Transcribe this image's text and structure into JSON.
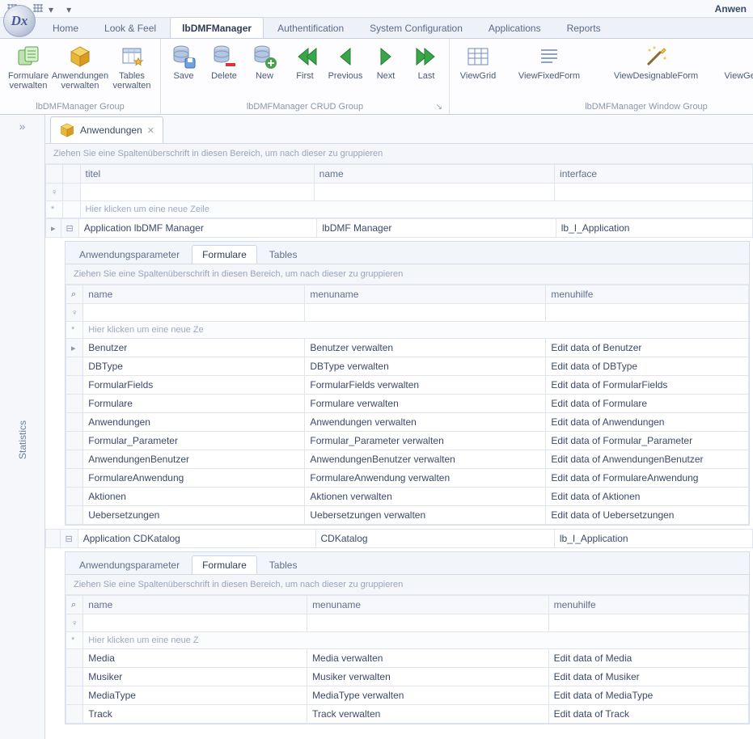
{
  "app_title": "Anwen",
  "tabs": [
    "Home",
    "Look & Feel",
    "lbDMFManager",
    "Authentification",
    "System Configuration",
    "Applications",
    "Reports"
  ],
  "active_tab_index": 2,
  "ribbon": {
    "groups": [
      {
        "caption": "lbDMFManager Group",
        "buttons": [
          {
            "label": "Formulare verwalten",
            "icon": "forms-icon"
          },
          {
            "label": "Anwendungen verwalten",
            "icon": "cube-icon"
          },
          {
            "label": "Tables verwalten",
            "icon": "table-star-icon"
          }
        ]
      },
      {
        "caption": "lbDMFManager CRUD Group",
        "buttons": [
          {
            "label": "Save",
            "icon": "db-save-icon"
          },
          {
            "label": "Delete",
            "icon": "db-delete-icon"
          },
          {
            "label": "New",
            "icon": "db-add-icon"
          },
          {
            "label": "First",
            "icon": "nav-first-icon"
          },
          {
            "label": "Previous",
            "icon": "nav-prev-icon"
          },
          {
            "label": "Next",
            "icon": "nav-next-icon"
          },
          {
            "label": "Last",
            "icon": "nav-last-icon"
          }
        ]
      },
      {
        "caption": "lbDMFManager Window Group",
        "buttons": [
          {
            "label": "ViewGrid",
            "icon": "grid-icon"
          },
          {
            "label": "ViewFixedForm",
            "icon": "form-lines-icon"
          },
          {
            "label": "ViewDesignableForm",
            "icon": "wand-icon"
          },
          {
            "label": "ViewGenericDataLayoutFor",
            "icon": "wand-gear-icon"
          }
        ]
      }
    ]
  },
  "sidebar_label": "Statistics",
  "doc_tab": "Anwendungen",
  "group_hint": "Ziehen Sie eine Spaltenüberschrift in diesen Bereich, um nach dieser zu gruppieren",
  "outer_columns": [
    "titel",
    "name",
    "interface"
  ],
  "new_row_hint": "Hier klicken um eine neue Zeile",
  "new_row_hint2": "Hier klicken um eine neue Ze",
  "new_row_hint3": "Hier klicken um eine neue Z",
  "inner_tabs": [
    "Anwendungsparameter",
    "Formulare",
    "Tables"
  ],
  "inner_active": 1,
  "inner_columns_sym": "⌕",
  "inner_columns": [
    "name",
    "menuname",
    "menuhilfe"
  ],
  "masters": [
    {
      "titel": "Application lbDMF Manager",
      "name": "lbDMF Manager",
      "interface": "lb_I_Application",
      "details": [
        {
          "name": "Benutzer",
          "menuname": "Benutzer verwalten",
          "menuhilfe": "Edit data of Benutzer"
        },
        {
          "name": "DBType",
          "menuname": "DBType verwalten",
          "menuhilfe": "Edit data of DBType"
        },
        {
          "name": "FormularFields",
          "menuname": "FormularFields verwalten",
          "menuhilfe": "Edit data of FormularFields"
        },
        {
          "name": "Formulare",
          "menuname": "Formulare verwalten",
          "menuhilfe": "Edit data of Formulare"
        },
        {
          "name": "Anwendungen",
          "menuname": "Anwendungen verwalten",
          "menuhilfe": "Edit data of Anwendungen"
        },
        {
          "name": "Formular_Parameter",
          "menuname": "Formular_Parameter verwalten",
          "menuhilfe": "Edit data of Formular_Parameter"
        },
        {
          "name": "AnwendungenBenutzer",
          "menuname": "AnwendungenBenutzer verwalten",
          "menuhilfe": "Edit data of AnwendungenBenutzer"
        },
        {
          "name": "FormulareAnwendung",
          "menuname": "FormulareAnwendung verwalten",
          "menuhilfe": "Edit data of FormulareAnwendung"
        },
        {
          "name": "Aktionen",
          "menuname": "Aktionen verwalten",
          "menuhilfe": "Edit data of Aktionen"
        },
        {
          "name": "Uebersetzungen",
          "menuname": "Uebersetzungen verwalten",
          "menuhilfe": "Edit data of Uebersetzungen"
        }
      ]
    },
    {
      "titel": "Application CDKatalog",
      "name": "CDKatalog",
      "interface": "lb_I_Application",
      "details": [
        {
          "name": "Media",
          "menuname": "Media verwalten",
          "menuhilfe": "Edit data of Media"
        },
        {
          "name": "Musiker",
          "menuname": "Musiker verwalten",
          "menuhilfe": "Edit data of Musiker"
        },
        {
          "name": "MediaType",
          "menuname": "MediaType verwalten",
          "menuhilfe": "Edit data of MediaType"
        },
        {
          "name": "Track",
          "menuname": "Track verwalten",
          "menuhilfe": "Edit data of Track"
        }
      ]
    }
  ]
}
